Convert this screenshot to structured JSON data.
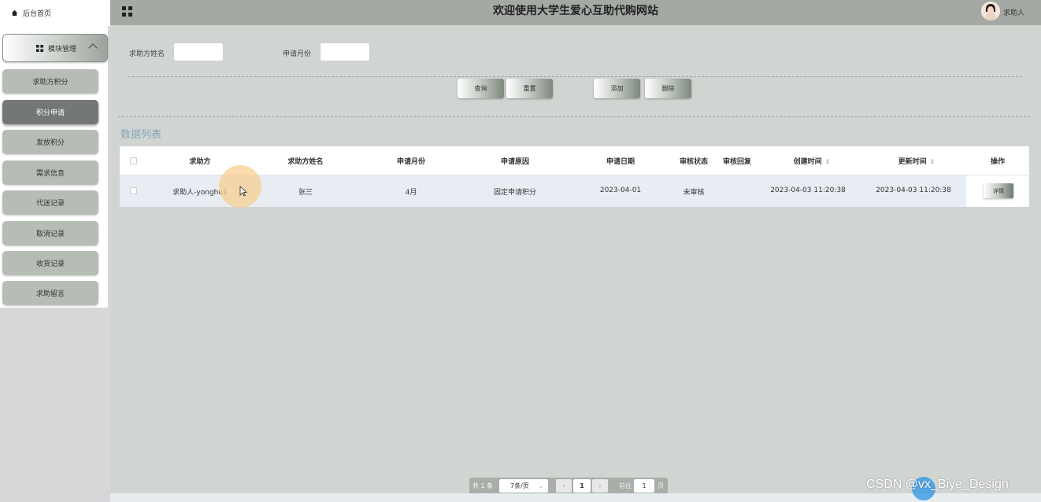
{
  "sidebar": {
    "home_label": "后台首页",
    "module_label": "模块管理",
    "items": [
      {
        "label": "求助方积分"
      },
      {
        "label": "积分申请"
      },
      {
        "label": "发放积分"
      },
      {
        "label": "需求信息"
      },
      {
        "label": "代送记录"
      },
      {
        "label": "取消记录"
      },
      {
        "label": "收货记录"
      },
      {
        "label": "求助留言"
      }
    ],
    "active_index": 1
  },
  "header": {
    "title": "欢迎使用大学生爱心互助代购网站",
    "user_name": "求助人"
  },
  "search": {
    "name_label": "求助方姓名",
    "name_value": "",
    "month_label": "申请月份",
    "month_value": ""
  },
  "actions": {
    "query": "查询",
    "reset": "重置",
    "add": "添加",
    "delete": "删除"
  },
  "section_title": "数据列表",
  "table": {
    "headers": {
      "helper": "求助方",
      "helper_name": "求助方姓名",
      "month": "申请月份",
      "reason": "申请原因",
      "date": "申请日期",
      "status": "审核状态",
      "reply": "审核回复",
      "created": "创建时间",
      "updated": "更新时间",
      "ops": "操作"
    },
    "rows": [
      {
        "helper": "求助人-yonghu1",
        "helper_name": "张三",
        "month": "4月",
        "reason": "固定申请积分",
        "date": "2023-04-01",
        "status": "未审核",
        "reply": "",
        "created": "2023-04-03 11:20:38",
        "updated": "2023-04-03 11:20:38",
        "detail": "详情"
      }
    ]
  },
  "pagination": {
    "total": "共 1 条",
    "page_size": "7条/页",
    "current": "1",
    "goto_label": "前往",
    "goto_value": "1",
    "page_suffix": "页"
  },
  "watermark": "CSDN @vx_Biye_Design"
}
